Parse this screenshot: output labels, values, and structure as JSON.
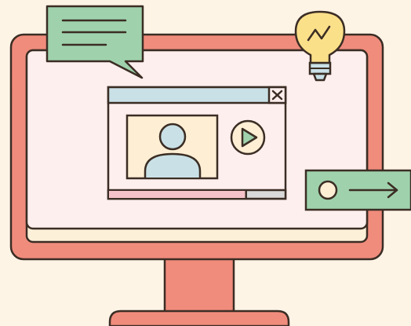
{
  "palette": {
    "background": "#fdf4e6",
    "outline": "#3b2d24",
    "monitor_frame": "#f08c7c",
    "screen": "#fcefed",
    "screen_bottom_band": "#fdf0d8",
    "window_titlebar": "#c9e1e6",
    "video_frame": "#fdeed4",
    "avatar": "#c9e1e6",
    "progress_played": "#f4c2c8",
    "progress_remaining": "#d9d9d9",
    "chat_bubble": "#9fd2ac",
    "lightbulb": "#fbe08a",
    "lightbulb_base": "#c9e1e6",
    "arrow_tag": "#9fd2ac",
    "tag_dot": "#fdeed4"
  },
  "icons": {
    "close_button": "close-icon",
    "play_button": "play-icon",
    "speech_bubble": "message-icon",
    "lightbulb": "lightbulb-icon",
    "arrow_tag": "arrow-right-icon",
    "avatar": "user-icon"
  },
  "video_player": {
    "progress_played_fraction": 0.78
  }
}
